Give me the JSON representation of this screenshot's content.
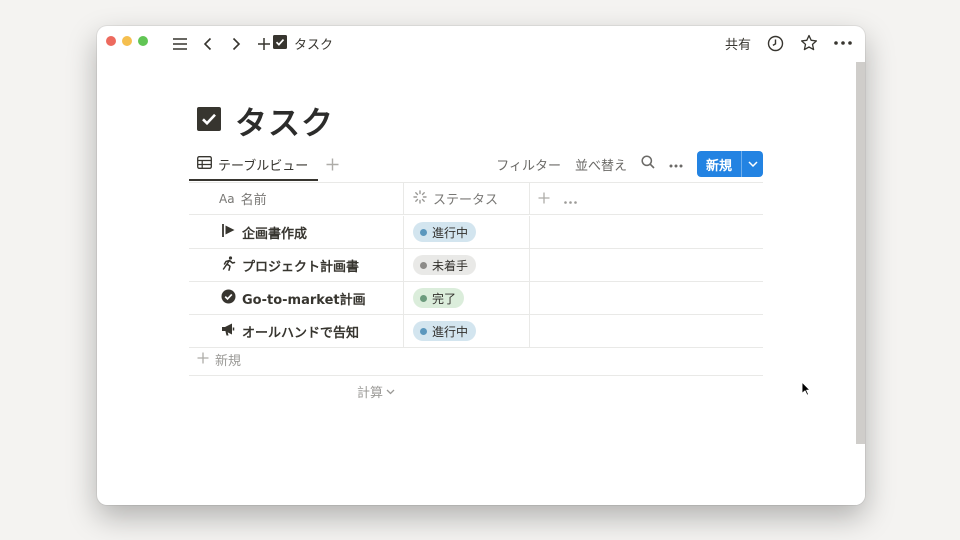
{
  "app": {
    "breadcrumb": "タスク",
    "share_label": "共有"
  },
  "page": {
    "title": "タスク"
  },
  "view": {
    "tab_label": "テーブルビュー",
    "filter_label": "フィルター",
    "sort_label": "並べ替え",
    "new_label": "新規"
  },
  "table": {
    "columns": [
      {
        "icon": "Aa",
        "label": "名前"
      },
      {
        "label": "ステータス"
      }
    ],
    "rows": [
      {
        "icon": "flag-icon",
        "name": "企画書作成",
        "status": "進行中",
        "status_type": "progress"
      },
      {
        "icon": "runner-icon",
        "name": "プロジェクト計画書",
        "status": "未着手",
        "status_type": "todo"
      },
      {
        "icon": "check-circle-icon",
        "name": "Go-to-market計画",
        "status": "完了",
        "status_type": "done"
      },
      {
        "icon": "megaphone-icon",
        "name": "オールハンドで告知",
        "status": "進行中",
        "status_type": "progress"
      }
    ],
    "add_row_label": "新規",
    "calc_label": "計算"
  },
  "colors": {
    "accent": "#2383e2",
    "status_progress_bg": "#d3e5ef",
    "status_todo_bg": "#e9e9e7",
    "status_done_bg": "#dbeddb"
  }
}
